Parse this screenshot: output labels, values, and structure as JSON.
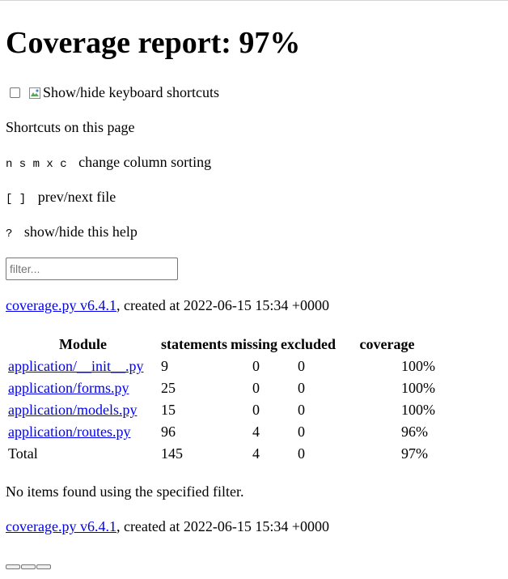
{
  "header": {
    "title": "Coverage report: 97%",
    "shortcuts_toggle_alt": "Show/hide keyboard shortcuts"
  },
  "help": {
    "heading": "Shortcuts on this page",
    "items": [
      {
        "keys": "n s m x c",
        "desc": "change column sorting"
      },
      {
        "keys": "[ ]",
        "desc": "prev/next file"
      },
      {
        "keys": "?",
        "desc": "show/hide this help"
      }
    ]
  },
  "filter": {
    "placeholder": "filter...",
    "value": ""
  },
  "created": {
    "link": "coverage.py v6.4.1",
    "text": ", created at 2022-06-15 15:34 +0000"
  },
  "table": {
    "headers": [
      "Module",
      "statements",
      "missing",
      "excluded",
      "coverage"
    ],
    "rows": [
      {
        "module": "application/__init__.py",
        "statements": "9",
        "missing": "0",
        "excluded": "0",
        "coverage": "100%"
      },
      {
        "module": "application/forms.py",
        "statements": "25",
        "missing": "0",
        "excluded": "0",
        "coverage": "100%"
      },
      {
        "module": "application/models.py",
        "statements": "15",
        "missing": "0",
        "excluded": "0",
        "coverage": "100%"
      },
      {
        "module": "application/routes.py",
        "statements": "96",
        "missing": "4",
        "excluded": "0",
        "coverage": "96%"
      }
    ],
    "total": {
      "label": "Total",
      "statements": "145",
      "missing": "4",
      "excluded": "0",
      "coverage": "97%"
    }
  },
  "no_items": "No items found using the specified filter."
}
